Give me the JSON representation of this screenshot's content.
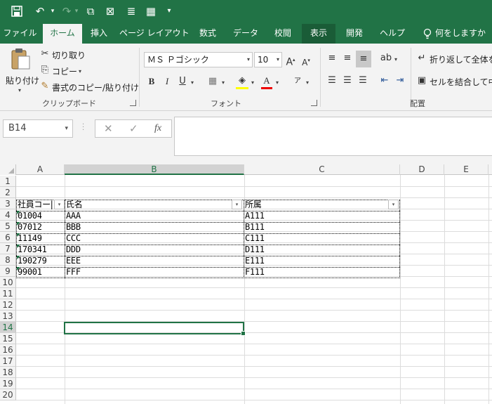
{
  "quick_access": {
    "save_icon": "save-icon",
    "undo_icon": "undo-icon",
    "redo_icon": "redo-icon"
  },
  "tabs": [
    {
      "label": "ファイル"
    },
    {
      "label": "ホーム"
    },
    {
      "label": "挿入"
    },
    {
      "label": "ページ レイアウト"
    },
    {
      "label": "数式"
    },
    {
      "label": "データ"
    },
    {
      "label": "校閲"
    },
    {
      "label": "表示"
    },
    {
      "label": "開発"
    },
    {
      "label": "ヘルプ"
    },
    {
      "label": "何をしますか"
    }
  ],
  "ribbon": {
    "clipboard": {
      "paste_label": "貼り付け",
      "cut_label": "切り取り",
      "copy_label": "コピー",
      "format_painter_label": "書式のコピー/貼り付け",
      "group_label": "クリップボード"
    },
    "font": {
      "font_name": "ＭＳ Ｐゴシック",
      "font_size": "10",
      "bold": "B",
      "italic": "I",
      "underline": "U",
      "group_label": "フォント"
    },
    "alignment": {
      "wrap_label": "折り返して全体を表",
      "merge_label": "セルを結合して中央",
      "group_label": "配置"
    }
  },
  "formula_bar": {
    "name_box": "B14",
    "cancel": "✕",
    "enter": "✓",
    "fx": "fx",
    "value": ""
  },
  "sheet": {
    "columns": [
      "A",
      "B",
      "C",
      "D",
      "E"
    ],
    "rows": [
      "1",
      "2",
      "3",
      "4",
      "5",
      "6",
      "7",
      "8",
      "9",
      "10",
      "11",
      "12",
      "13",
      "14",
      "15",
      "16",
      "17",
      "18",
      "19",
      "20"
    ],
    "selected_cell": "B14",
    "table_headers": [
      "社員コー|",
      "氏名",
      "所属"
    ],
    "table_rows": [
      [
        "01004",
        "AAA",
        "A111"
      ],
      [
        "07012",
        "BBB",
        "B111"
      ],
      [
        "11149",
        "CCC",
        "C111"
      ],
      [
        "170341",
        "DDD",
        "D111"
      ],
      [
        "190279",
        "EEE",
        "E111"
      ],
      [
        "99001",
        "FFF",
        "F111"
      ]
    ]
  }
}
